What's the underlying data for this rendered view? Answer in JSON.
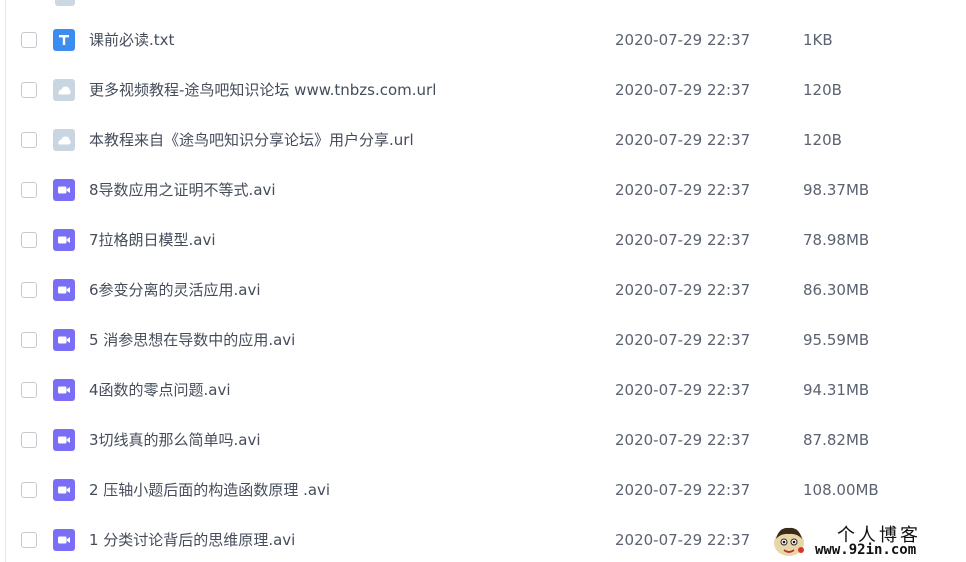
{
  "files": [
    {
      "name": "课前必读.txt",
      "date": "2020-07-29 22:37",
      "size": "1KB",
      "icon": "text-file-icon"
    },
    {
      "name": "更多视频教程-途鸟吧知识论坛 www.tnbzs.com.url",
      "date": "2020-07-29 22:37",
      "size": "120B",
      "icon": "link-file-icon"
    },
    {
      "name": "本教程来自《途鸟吧知识分享论坛》用户分享.url",
      "date": "2020-07-29 22:37",
      "size": "120B",
      "icon": "link-file-icon"
    },
    {
      "name": "8导数应用之证明不等式.avi",
      "date": "2020-07-29 22:37",
      "size": "98.37MB",
      "icon": "video-file-icon"
    },
    {
      "name": "7拉格朗日模型.avi",
      "date": "2020-07-29 22:37",
      "size": "78.98MB",
      "icon": "video-file-icon"
    },
    {
      "name": "6参变分离的灵活应用.avi",
      "date": "2020-07-29 22:37",
      "size": "86.30MB",
      "icon": "video-file-icon"
    },
    {
      "name": "5 消参思想在导数中的应用.avi",
      "date": "2020-07-29 22:37",
      "size": "95.59MB",
      "icon": "video-file-icon"
    },
    {
      "name": "4函数的零点问题.avi",
      "date": "2020-07-29 22:37",
      "size": "94.31MB",
      "icon": "video-file-icon"
    },
    {
      "name": "3切线真的那么简单吗.avi",
      "date": "2020-07-29 22:37",
      "size": "87.82MB",
      "icon": "video-file-icon"
    },
    {
      "name": "2 压轴小题后面的构造函数原理 .avi",
      "date": "2020-07-29 22:37",
      "size": "108.00MB",
      "icon": "video-file-icon"
    },
    {
      "name": "1 分类讨论背后的思维原理.avi",
      "date": "2020-07-29 22:37",
      "size": "",
      "icon": "video-file-icon"
    }
  ],
  "watermark": {
    "title": "个人博客",
    "url": "www.92in.com"
  },
  "colors": {
    "text_file": "#3d8cf0",
    "link_file": "#c9d6e2",
    "video_file": "#7b6ef6",
    "name_text": "#454d5a",
    "meta_text": "#5b6270"
  }
}
